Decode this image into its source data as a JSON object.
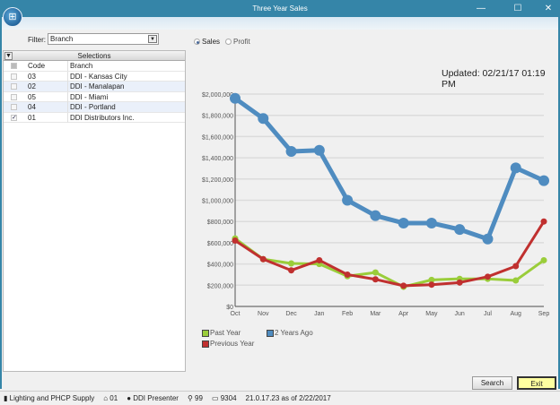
{
  "window": {
    "title": "Three Year Sales",
    "min": "—",
    "max": "☐",
    "close": "✕"
  },
  "filter": {
    "label": "Filter:",
    "value": "Branch"
  },
  "selections": {
    "title": "Selections",
    "columns": [
      "Code",
      "Branch"
    ],
    "rows": [
      {
        "code": "03",
        "branch": "DDI - Kansas City",
        "checked": false
      },
      {
        "code": "02",
        "branch": "DDI - Manalapan",
        "checked": false
      },
      {
        "code": "05",
        "branch": "DDI - Miami",
        "checked": false
      },
      {
        "code": "04",
        "branch": "DDI - Portland",
        "checked": false
      },
      {
        "code": "01",
        "branch": "DDI Distributors Inc.",
        "checked": true
      }
    ]
  },
  "mode": {
    "sales": "Sales",
    "profit": "Profit",
    "selected": "Sales"
  },
  "updated": "Updated: 02/21/17 01:19 PM",
  "chart_data": {
    "type": "line",
    "categories": [
      "Oct",
      "Nov",
      "Dec",
      "Jan",
      "Feb",
      "Mar",
      "Apr",
      "May",
      "Jun",
      "Jul",
      "Aug",
      "Sep"
    ],
    "ylim": [
      0,
      2000000
    ],
    "yticks": [
      "$0",
      "$200,000",
      "$400,000",
      "$600,000",
      "$800,000",
      "$1,000,000",
      "$1,200,000",
      "$1,400,000",
      "$1,600,000",
      "$1,800,000",
      "$2,000,000"
    ],
    "grid": true,
    "legend_placement": "bottom-left",
    "series": [
      {
        "name": "2 Years Ago",
        "color": "#4f8cc0",
        "values": [
          1960000,
          1770000,
          1460000,
          1470000,
          1000000,
          855000,
          785000,
          785000,
          725000,
          635000,
          1305000,
          1185000
        ]
      },
      {
        "name": "Past Year",
        "color": "#9acd3a",
        "values": [
          640000,
          445000,
          405000,
          400000,
          285000,
          320000,
          185000,
          250000,
          260000,
          260000,
          245000,
          435000
        ]
      },
      {
        "name": "Previous Year",
        "color": "#c0302f",
        "values": [
          620000,
          445000,
          340000,
          435000,
          300000,
          255000,
          195000,
          205000,
          225000,
          280000,
          380000,
          800000
        ]
      }
    ]
  },
  "buttons": {
    "search": "Search",
    "exit": "Exit"
  },
  "status": {
    "company": "Lighting and PHCP Supply",
    "branch": "01",
    "user": "DDI Presenter",
    "key": "99",
    "terminal": "9304",
    "version": "21.0.17.23 as of 2/22/2017"
  }
}
